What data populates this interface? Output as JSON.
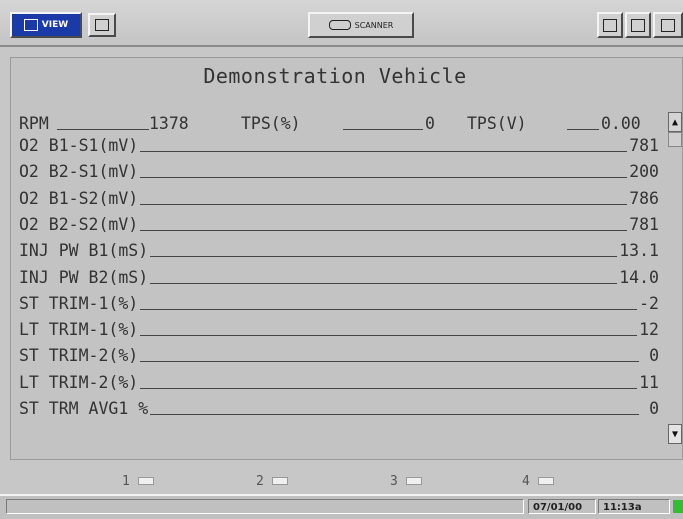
{
  "toolbar": {
    "view_label": "VIEW",
    "scanner_label": "SCANNER"
  },
  "screen": {
    "title": "Demonstration Vehicle",
    "top_row": {
      "rpm_label": "RPM",
      "rpm_value": "1378",
      "tps_pct_label": "TPS(%)",
      "tps_pct_value": "0",
      "tps_v_label": "TPS(V)",
      "tps_v_value": "0.00"
    },
    "rows": [
      {
        "label": "O2 B1-S1(mV)",
        "value": "781"
      },
      {
        "label": "O2 B2-S1(mV)",
        "value": "200"
      },
      {
        "label": "O2 B1-S2(mV)",
        "value": "786"
      },
      {
        "label": "O2 B2-S2(mV)",
        "value": "781"
      },
      {
        "label": "INJ PW B1(mS)",
        "value": "13.1"
      },
      {
        "label": "INJ PW B2(mS)",
        "value": "14.0"
      },
      {
        "label": "ST TRIM-1(%)",
        "value": "-2"
      },
      {
        "label": "LT TRIM-1(%)",
        "value": "12"
      },
      {
        "label": "ST TRIM-2(%)",
        "value": "0"
      },
      {
        "label": "LT TRIM-2(%)",
        "value": "11"
      },
      {
        "label": "ST TRM AVG1 %",
        "value": "0"
      }
    ]
  },
  "function_keys": [
    "1",
    "2",
    "3",
    "4"
  ],
  "status_bar": {
    "date": "07/01/00",
    "time": "11:13a",
    "led_color": "#2ec02e"
  },
  "icons": [
    "view-icon",
    "grid-icon",
    "scanner-icon",
    "window-icon",
    "print-icon",
    "close-icon",
    "scroll-up-icon",
    "scroll-down-icon",
    "function-key-icon"
  ]
}
